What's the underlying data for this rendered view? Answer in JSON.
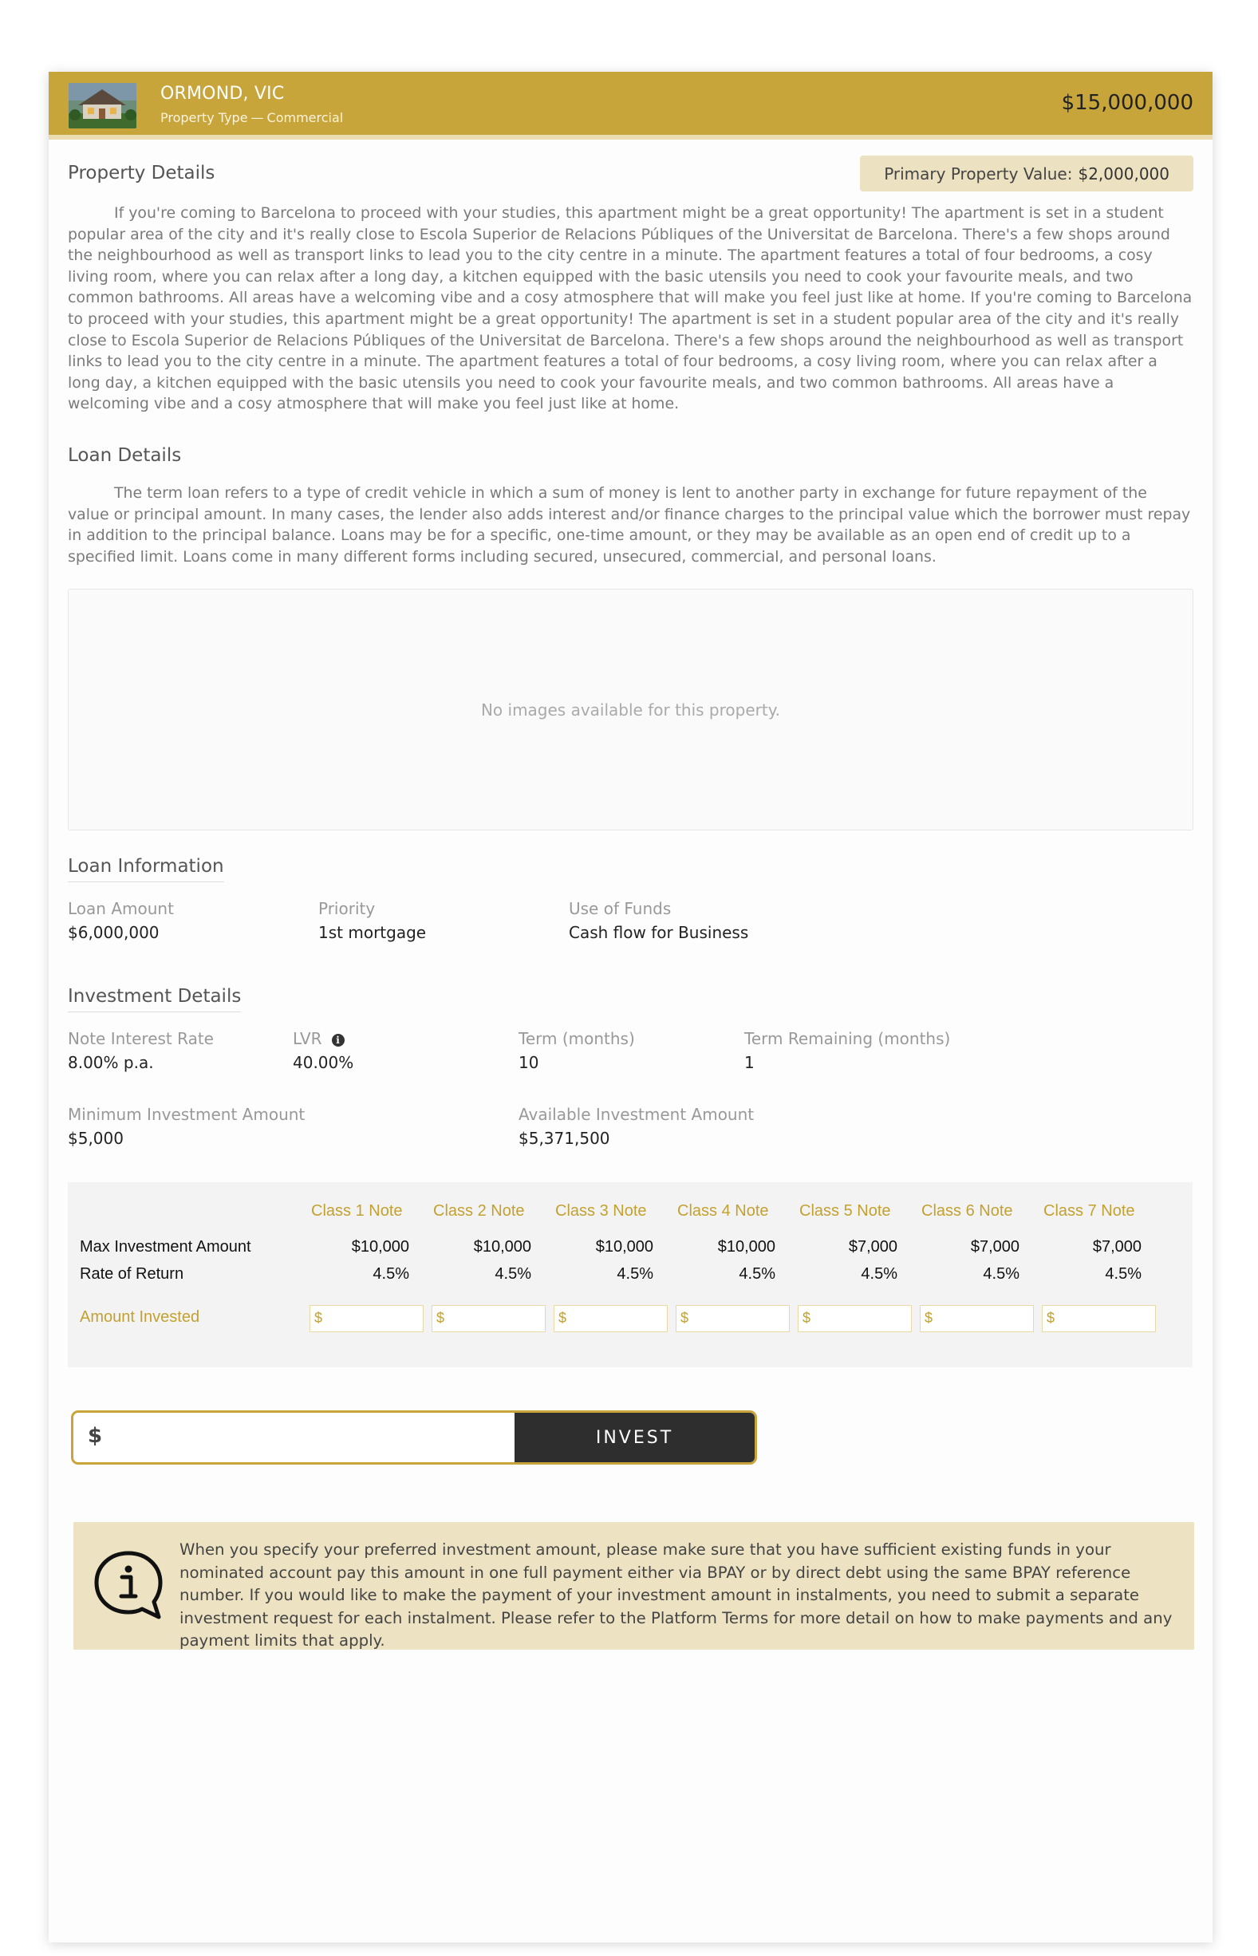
{
  "header": {
    "title": "ORMOND, VIC",
    "property_type_label": "Property Type",
    "property_type_value": "Commercial",
    "price": "$15,000,000"
  },
  "property_details": {
    "title": "Property Details",
    "primary_value_label": "Primary Property Value:",
    "primary_value": "$2,000,000",
    "description": "If you're coming to Barcelona to proceed with your studies, this apartment might be a great opportunity! The apartment is set in a student popular area of the city and it's really close to Escola Superior de Relacions Públiques of the Universitat de Barcelona. There's a few shops around the neighbourhood as well as transport links to lead you to the city centre in a minute. The apartment features a total of four bedrooms, a cosy living room, where you can relax after a long day, a kitchen equipped with the basic utensils you need to cook your favourite meals, and two common bathrooms. All areas have a welcoming vibe and a cosy atmosphere that will make you feel just like at home. If you're coming to Barcelona to proceed with your studies, this apartment might be a great opportunity! The apartment is set in a student popular area of the city and it's really close to Escola Superior de Relacions Públiques of the Universitat de Barcelona. There's a few shops around the neighbourhood as well as transport links to lead you to the city centre in a minute. The apartment features a total of four bedrooms, a cosy living room, where you can relax after a long day, a kitchen equipped with the basic utensils you need to cook your favourite meals, and two common bathrooms. All areas have a welcoming vibe and a cosy atmosphere that will make you feel just like at home."
  },
  "loan_details": {
    "title": "Loan Details",
    "description": "The term loan refers to a type of credit vehicle in which a sum of money is lent to another party in exchange for future repayment of the value or principal amount. In many cases, the lender also adds interest and/or finance charges to the principal value which the borrower must repay in addition to the principal balance. Loans may be for a specific, one-time amount, or they may be available as an  open end of credit up to a specified limit. Loans come in many different forms including secured, unsecured, commercial, and personal loans."
  },
  "images": {
    "empty_text": "No images available for this property."
  },
  "loan_information": {
    "title": "Loan Information",
    "loan_amount_label": "Loan Amount",
    "loan_amount": "$6,000,000",
    "priority_label": "Priority",
    "priority": "1st mortgage",
    "use_of_funds_label": "Use of Funds",
    "use_of_funds": "Cash flow for Business"
  },
  "investment_details": {
    "title": "Investment Details",
    "note_rate_label": "Note Interest Rate",
    "note_rate": "8.00% p.a.",
    "lvr_label": "LVR",
    "lvr": "40.00%",
    "term_label": "Term (months)",
    "term": "10",
    "term_remaining_label": "Term Remaining (months)",
    "term_remaining": "1",
    "min_invest_label": "Minimum Investment Amount",
    "min_invest": "$5,000",
    "available_label": "Available Investment Amount",
    "available": "$5,371,500"
  },
  "notes_table": {
    "row_labels": {
      "max": "Max Investment Amount",
      "rate": "Rate of Return",
      "invested": "Amount Invested"
    },
    "input_prefix": "$",
    "columns": [
      {
        "name": "Class 1 Note",
        "max": "$10,000",
        "rate": "4.5%"
      },
      {
        "name": "Class 2 Note",
        "max": "$10,000",
        "rate": "4.5%"
      },
      {
        "name": "Class 3 Note",
        "max": "$10,000",
        "rate": "4.5%"
      },
      {
        "name": "Class 4 Note",
        "max": "$10,000",
        "rate": "4.5%"
      },
      {
        "name": "Class 5 Note",
        "max": "$7,000",
        "rate": "4.5%"
      },
      {
        "name": "Class 6 Note",
        "max": "$7,000",
        "rate": "4.5%"
      },
      {
        "name": "Class 7 Note",
        "max": "$7,000",
        "rate": "4.5%"
      }
    ]
  },
  "invest": {
    "prefix": "$",
    "button_label": "INVEST"
  },
  "notice": {
    "icon": "info-speech-bubble-icon",
    "text": "When you specify your preferred investment amount, please make sure that you have sufficient existing funds in your nominated account pay this amount in one full payment either via BPAY or by direct debt using the same BPAY reference number. If you would like to make the payment of your investment amount in instalments, you need to submit a separate investment request for each instalment. Please refer to the Platform Terms for more detail on how to make payments and any payment limits that apply."
  },
  "colors": {
    "accent": "#c8a53a",
    "notice_bg": "#ede3c3",
    "button": "#2e2e2e"
  }
}
